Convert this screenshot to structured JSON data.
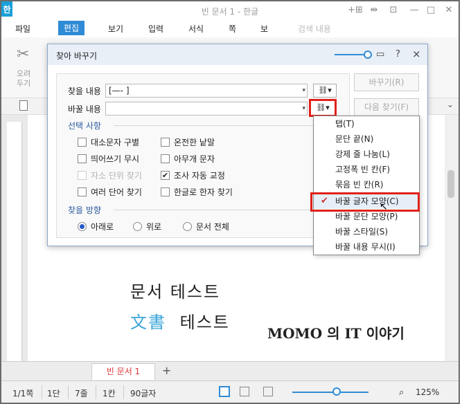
{
  "window": {
    "app_icon": "한",
    "title": "빈 문서 1 - 한글",
    "controls": [
      "+⊞",
      "⇹",
      "⊡",
      "—",
      "□",
      "✕"
    ]
  },
  "menubar": {
    "items": [
      "파일",
      "편집",
      "보기",
      "입력",
      "서식",
      "쪽",
      "보"
    ],
    "active": "편집",
    "search_placeholder": "검색 내용"
  },
  "ribbon": {
    "cut_label": "오려\n두기"
  },
  "document": {
    "line1": "문서 테스트",
    "line2_han": "文書",
    "line2_rest": "테스트",
    "brand": "MOMO 의 IT 이야기",
    "tab": "빈 문서 1",
    "add_tab": "+"
  },
  "statusbar": {
    "page": "1/1쪽",
    "section": "1단",
    "line": "7줄",
    "column": "1칸",
    "chars": "90글자",
    "zoom": "125%"
  },
  "dialog": {
    "title": "찾아 바꾸기",
    "help": "?",
    "close": "×",
    "find_label": "찾을 내용",
    "find_value": "[—-   ]",
    "replace_label": "바꿀 내용",
    "replace_value": "",
    "options_title": "선택 사항",
    "options": [
      {
        "label": "대소문자 구별",
        "checked": false,
        "disabled": false
      },
      {
        "label": "온전한 낱말",
        "checked": false,
        "disabled": false
      },
      {
        "label": "띄어쓰기 무시",
        "checked": false,
        "disabled": false
      },
      {
        "label": "아무개 문자",
        "checked": false,
        "disabled": false
      },
      {
        "label": "자소 단위 찾기",
        "checked": false,
        "disabled": true
      },
      {
        "label": "조사 자동 교정",
        "checked": true,
        "disabled": false
      },
      {
        "label": "여러 단어 찾기",
        "checked": false,
        "disabled": false
      },
      {
        "label": "한글로 한자 찾기",
        "checked": false,
        "disabled": false
      }
    ],
    "direction_title": "찾을 방향",
    "directions": [
      {
        "label": "아래로",
        "selected": true
      },
      {
        "label": "위로",
        "selected": false
      },
      {
        "label": "문서 전체",
        "selected": false
      }
    ],
    "buttons": [
      "바꾸기(R)",
      "다음 찾기(F)"
    ]
  },
  "dropdown": {
    "items": [
      {
        "label": "탭(T)",
        "checked": false
      },
      {
        "label": "문단 끝(N)",
        "checked": false
      },
      {
        "label": "강제 줄 나눔(L)",
        "checked": false
      },
      {
        "label": "고정폭 빈 칸(F)",
        "checked": false
      },
      {
        "label": "묶음 빈 칸(R)",
        "checked": false
      },
      {
        "label": "바꿀 글자 모양(C)",
        "checked": true
      },
      {
        "label": "바꿀 문단 모양(P)",
        "checked": false
      },
      {
        "label": "바꿀 스타일(S)",
        "checked": false
      },
      {
        "label": "바꿀 내용 무시(I)",
        "checked": false
      }
    ]
  },
  "colors": {
    "accent": "#2f8bd6",
    "highlight": "#e0211a",
    "hanja": "#3aa5d8"
  }
}
